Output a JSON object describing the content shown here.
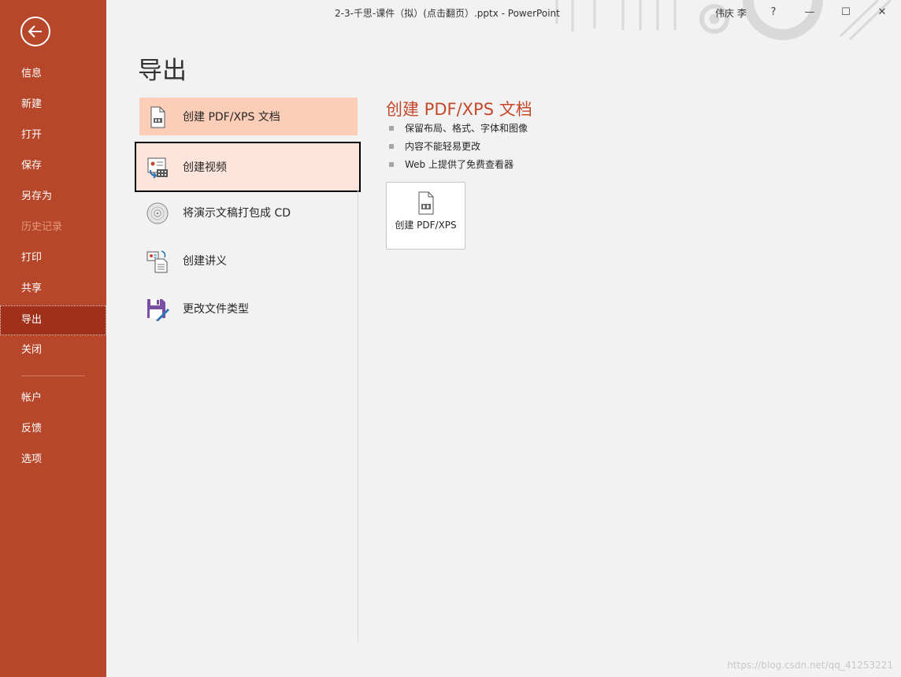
{
  "window": {
    "document_title": "2-3-千思-课件（拟）(点击翻页）.pptx  -  PowerPoint",
    "user": "伟庆 李",
    "help": "?",
    "minimize": "—",
    "maximize": "☐",
    "close": "✕"
  },
  "sidebar": {
    "back_icon": "back-arrow-icon",
    "items": [
      {
        "label": "信息"
      },
      {
        "label": "新建"
      },
      {
        "label": "打开"
      },
      {
        "label": "保存"
      },
      {
        "label": "另存为"
      },
      {
        "label": "历史记录",
        "state": "disabled"
      },
      {
        "label": "打印"
      },
      {
        "label": "共享"
      },
      {
        "label": "导出",
        "state": "active"
      },
      {
        "label": "关闭"
      },
      {
        "label": "帐户"
      },
      {
        "label": "反馈"
      },
      {
        "label": "选项"
      }
    ]
  },
  "page": {
    "title": "导出"
  },
  "export_options": [
    {
      "label": "创建 PDF/XPS 文档",
      "icon": "pdf-document-icon",
      "state": "selected"
    },
    {
      "label": "创建视频",
      "icon": "video-icon",
      "state": "hover"
    },
    {
      "label": "将演示文稿打包成 CD",
      "icon": "cd-icon"
    },
    {
      "label": "创建讲义",
      "icon": "handout-icon"
    },
    {
      "label": "更改文件类型",
      "icon": "save-file-type-icon"
    }
  ],
  "detail": {
    "title": "创建 PDF/XPS 文档",
    "bullets": [
      "保留布局、格式、字体和图像",
      "内容不能轻易更改",
      "Web 上提供了免费查看器"
    ],
    "button_label": "创建 PDF/XPS",
    "button_icon": "pdf-document-icon"
  },
  "watermark": "https://blog.csdn.net/qq_41253221",
  "colors": {
    "sidebar": "#b7472a",
    "sidebar_active": "#a0301a",
    "selected_item": "#fccdb7",
    "hover_item": "#fde5dc",
    "accent_text": "#c5482a"
  }
}
